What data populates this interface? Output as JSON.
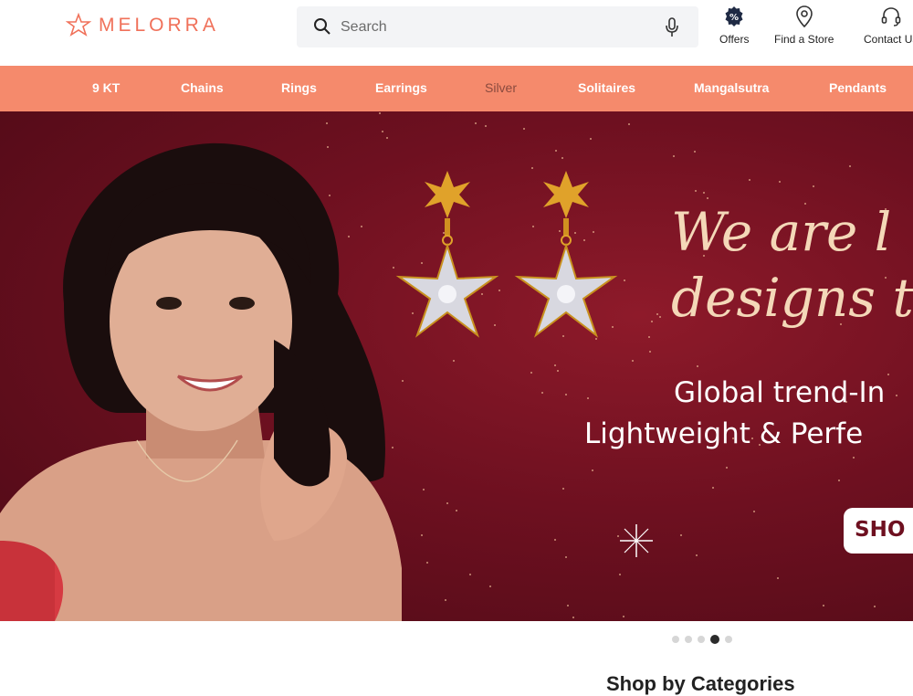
{
  "header": {
    "logo_text": "MELORRA",
    "search": {
      "placeholder": "Search"
    },
    "actions": [
      {
        "label": "Offers",
        "icon": "offers-percent-icon"
      },
      {
        "label": "Find a Store",
        "icon": "location-pin-icon"
      },
      {
        "label": "Contact Us",
        "icon": "headset-icon"
      }
    ]
  },
  "nav": {
    "items": [
      "9 KT",
      "Chains",
      "Rings",
      "Earrings",
      "Silver",
      "Solitaires",
      "Mangalsutra",
      "Pendants"
    ]
  },
  "banner": {
    "headline_line1": "We are l",
    "headline_line2": "designs th",
    "sub_line1": "Global trend-In",
    "sub_line2": "Lightweight & Perfe",
    "cta": "SHO"
  },
  "carousel": {
    "total": 5,
    "active_index": 3
  },
  "sections": {
    "shop_by_categories": "Shop by Categories"
  },
  "colors": {
    "brand": "#f0715a",
    "nav_bg": "#f58a6c",
    "banner_bg": "#6e1020"
  }
}
